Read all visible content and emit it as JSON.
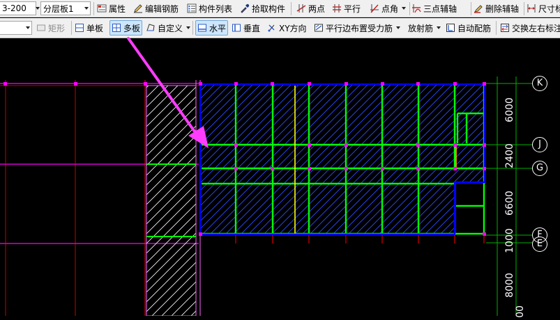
{
  "toolbar_top": {
    "spec_value": "3-200",
    "layer_value": "分层板1",
    "properties": "属性",
    "edit_rebar": "编辑钢筋",
    "component_list": "构件列表",
    "pick_component": "拾取构件",
    "two_points": "两点",
    "parallel": "平行",
    "point_angle": "点角",
    "three_point_axis": "三点辅轴",
    "delete_axis": "删除辅轴",
    "dimension": "尺寸标"
  },
  "toolbar_draw": {
    "rectangle": "矩形",
    "single_slab": "单板",
    "multi_slab": "多板",
    "custom": "自定义",
    "horizontal": "水平",
    "vertical": "垂直",
    "xy_direction": "XY方向",
    "parallel_edge": "平行边布置受力筋",
    "radial_rebar": "放射筋",
    "auto_rebar": "自动配筋",
    "swap_labels": "交换左右标注"
  },
  "axis_labels": {
    "k": "K",
    "j": "J",
    "g": "G",
    "f": "F",
    "e": "E"
  },
  "dimensions": {
    "d6000": "6000",
    "d2400": "2400",
    "d6600": "6600",
    "d1000": "1000",
    "d8000": "8000",
    "d_partial": "00"
  },
  "colors": {
    "toolbar_bg": "#f0f0f0",
    "canvas_bg": "#000000",
    "slab_outline": "#0000ff",
    "beam_green": "#00ff00",
    "grid_red": "#ff0000",
    "axis_magenta": "#ff00ff",
    "dim_green": "#00c000",
    "rebar_yellow": "#ffff00",
    "arrow": "#ff3cff"
  },
  "icons": {
    "properties": "properties-icon",
    "edit_rebar": "pencil-icon",
    "component_list": "list-icon",
    "pick": "eyedropper-icon",
    "two_points": "two-point-axis-icon",
    "parallel": "parallel-axis-icon",
    "point_angle": "point-angle-axis-icon",
    "three_point_axis": "three-point-axis-icon",
    "delete_axis": "delete-axis-icon",
    "single_slab": "single-slab-icon",
    "multi_slab": "multi-slab-icon",
    "custom": "custom-shape-icon",
    "horizontal": "horizontal-rebar-icon",
    "vertical": "vertical-rebar-icon",
    "xy": "xy-direction-icon",
    "parallel_edge": "parallel-edge-rebar-icon",
    "auto_rebar": "auto-rebar-icon",
    "swap": "swap-labels-icon"
  }
}
